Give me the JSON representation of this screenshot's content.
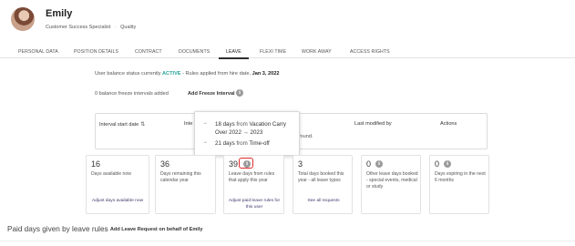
{
  "profile": {
    "name": "Emily",
    "role": "Customer Success Specialist",
    "separator": "·",
    "department": "Quality"
  },
  "tabs": [
    {
      "label": "PERSONAL DATA"
    },
    {
      "label": "POSITION DETAILS"
    },
    {
      "label": "CONTRACT"
    },
    {
      "label": "DOCUMENTS"
    },
    {
      "label": "LEAVE",
      "active": true
    },
    {
      "label": "FLEXI TIME"
    },
    {
      "label": "WORK AWAY"
    },
    {
      "label": "ACCESS RIGHTS"
    }
  ],
  "status": {
    "prefix": "User balance status currently",
    "state": "ACTIVE",
    "middle": " - Rules applied from hire date,",
    "date": "Jan 3, 2022",
    "active_color": "#27a59a"
  },
  "freeze": {
    "text": "0 balance freeze intervals added",
    "link": "Add Freeze Interval",
    "icon": "info-icon"
  },
  "table": {
    "headers": [
      "Interval start date",
      "Inte",
      "Last modified by",
      "Actions"
    ],
    "empty_text": "found."
  },
  "tooltip": {
    "rows": [
      {
        "amount": "18 days",
        "from": "from",
        "source": "Vacation Carry Over 2022 → 2023"
      },
      {
        "amount": "21 days",
        "from": "from",
        "source": "Time-off"
      }
    ],
    "arrow": "→"
  },
  "cards": [
    {
      "num": "16",
      "label": "Days available now",
      "link": "Adjust days available now"
    },
    {
      "num": "36",
      "label": "Days remaining this calendar year",
      "link": ""
    },
    {
      "num": "39",
      "label": "Leave days from rules that apply this year",
      "link": "Adjust paid leave rules for this user"
    },
    {
      "num": "3",
      "label": "Total days booked this year - all leave types",
      "link": "See all requests"
    },
    {
      "num": "0",
      "label": "Other leave days booked - special events, medical or study",
      "link": ""
    },
    {
      "num": "0",
      "label": "Days expiring in the next 6 months",
      "link": ""
    }
  ],
  "info_glyph": "i",
  "sort_glyph": "⇅",
  "bottom": {
    "title": "Paid days given by leave rules",
    "dot": "·",
    "link": "Add Leave Request on behalf of Emily"
  }
}
